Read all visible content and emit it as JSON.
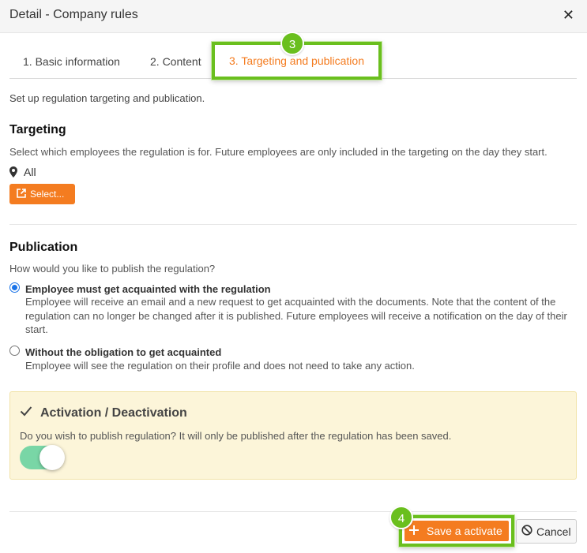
{
  "dialog": {
    "title": "Detail - Company rules",
    "close_icon": "close-icon",
    "close_glyph": "✕"
  },
  "tabs": [
    {
      "label": "1. Basic information",
      "active": false
    },
    {
      "label": "2. Content",
      "active": false
    },
    {
      "label": "3. Targeting and publication",
      "active": true
    }
  ],
  "callouts": {
    "step3": "3",
    "step4": "4"
  },
  "intro": "Set up regulation targeting and publication.",
  "targeting": {
    "title": "Targeting",
    "description": "Select which employees the regulation is for. Future employees are only included in the targeting on the day they start.",
    "selected_value": "All",
    "select_button": "Select..."
  },
  "publication": {
    "title": "Publication",
    "question": "How would you like to publish the regulation?",
    "options": [
      {
        "label": "Employee must get acquainted with the regulation",
        "description": "Employee will receive an email and a new request to get acquainted with the documents. Note that the content of the regulation can no longer be changed after it is published. Future employees will receive a notification on the day of their start.",
        "selected": true
      },
      {
        "label": "Without the obligation to get acquainted",
        "description": "Employee will see the regulation on their profile and does not need to take any action.",
        "selected": false
      }
    ]
  },
  "activation": {
    "title": "Activation / Deactivation",
    "description": "Do you wish to publish regulation? It will only be published after the regulation has been saved.",
    "enabled": true
  },
  "footer": {
    "save_label": "Save a activate",
    "cancel_label": "Cancel"
  },
  "colors": {
    "accent_orange": "#f47c20",
    "callout_green": "#6abf1e",
    "toggle_on": "#79d6a6",
    "activation_bg": "#fcf5d9",
    "radio_blue": "#1a73e8"
  }
}
